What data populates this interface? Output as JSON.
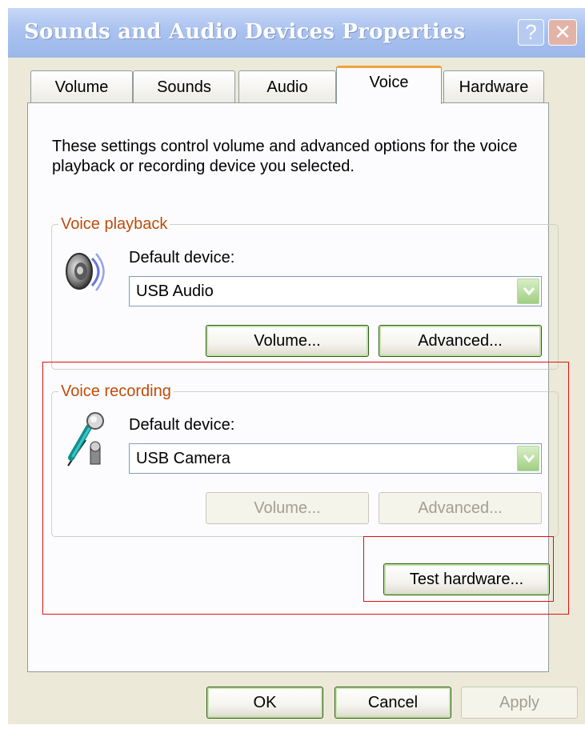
{
  "window": {
    "title": "Sounds and Audio Devices Properties",
    "help_label": "?",
    "close_label": "✕"
  },
  "tabs": [
    {
      "label": "Volume",
      "active": false
    },
    {
      "label": "Sounds",
      "active": false
    },
    {
      "label": "Audio",
      "active": false
    },
    {
      "label": "Voice",
      "active": true
    },
    {
      "label": "Hardware",
      "active": false
    }
  ],
  "description": "These settings control volume and advanced options for the voice playback or recording device you selected.",
  "playback": {
    "legend": "Voice playback",
    "icon": "speaker-icon",
    "device_label": "Default device:",
    "device_value": "USB Audio",
    "volume_label": "Volume...",
    "advanced_label": "Advanced..."
  },
  "recording": {
    "legend": "Voice recording",
    "icon": "microphone-icon",
    "device_label": "Default device:",
    "device_value": "USB Camera",
    "volume_label": "Volume...",
    "advanced_label": "Advanced..."
  },
  "test_hardware_label": "Test hardware...",
  "footer": {
    "ok_label": "OK",
    "cancel_label": "Cancel",
    "apply_label": "Apply"
  },
  "colors": {
    "accent_tab": "#f0a23a",
    "legend_text": "#bf4b0a",
    "annotation": "#e01010"
  }
}
